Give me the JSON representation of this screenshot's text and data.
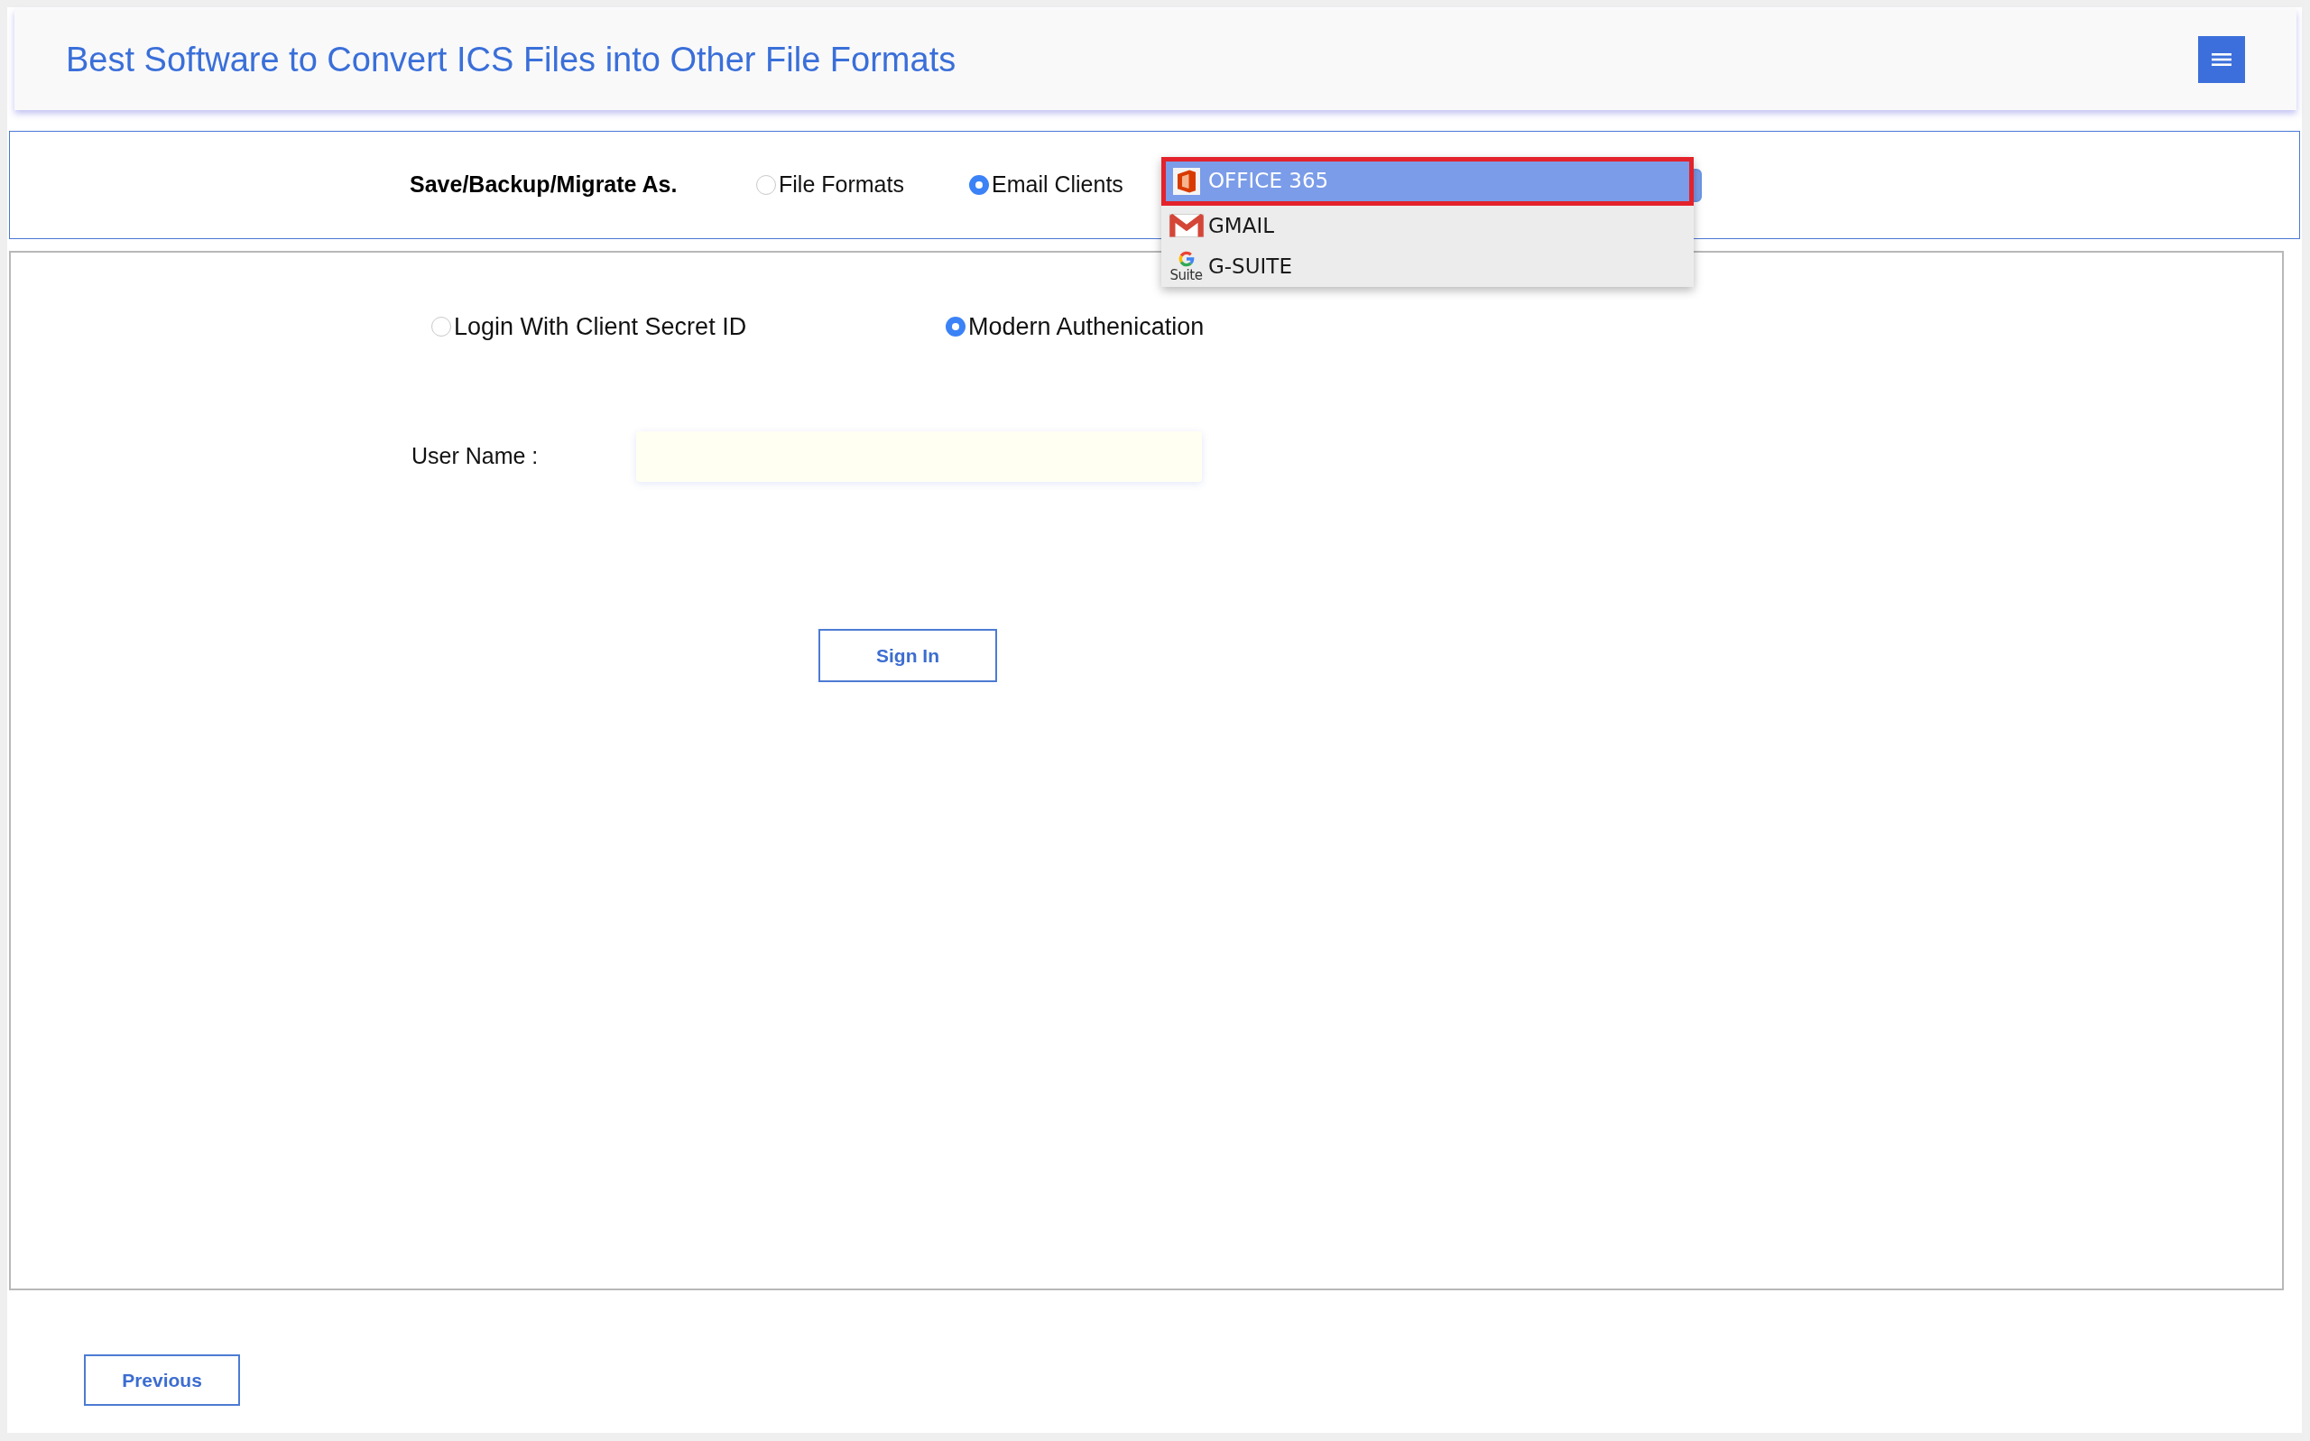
{
  "header": {
    "title": "Best Software to Convert ICS Files into Other File Formats"
  },
  "save_as": {
    "label": "Save/Backup/Migrate As.",
    "options": [
      {
        "label": "File Formats",
        "selected": false
      },
      {
        "label": "Email Clients",
        "selected": true
      }
    ],
    "client_list": [
      {
        "kind": "office",
        "label": "OFFICE 365",
        "selected": true
      },
      {
        "kind": "gmail",
        "label": "GMAIL",
        "selected": false
      },
      {
        "kind": "gsuite",
        "label": "G-SUITE",
        "icon_caption": "Suite",
        "selected": false
      }
    ]
  },
  "login": {
    "options": [
      {
        "label": "Login With Client Secret ID",
        "selected": false
      },
      {
        "label": "Modern Authenication",
        "selected": true
      }
    ],
    "user_name": {
      "label": "User Name :"
    },
    "sign_in": "Sign In"
  },
  "footer": {
    "previous": "Previous"
  }
}
